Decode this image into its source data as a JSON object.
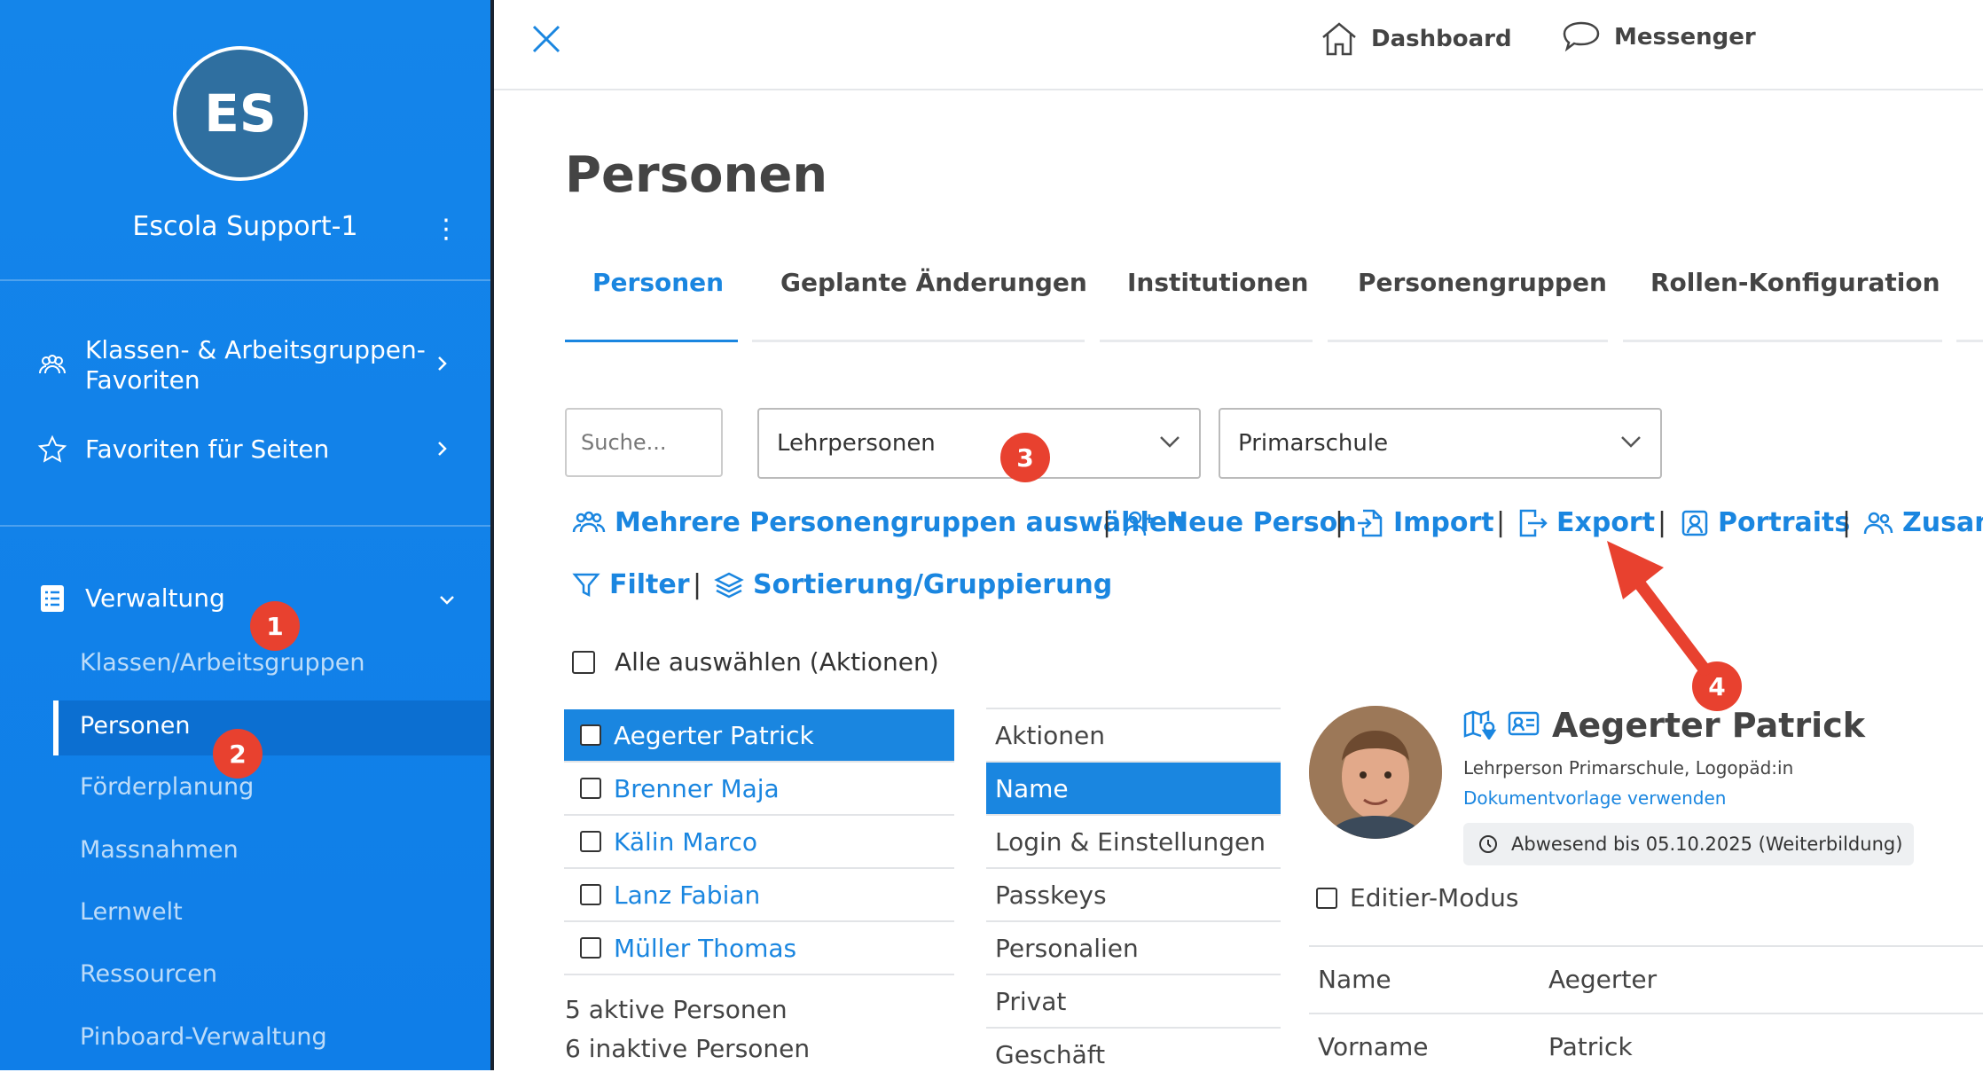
{
  "sidebar": {
    "avatar_initials": "ES",
    "username": "Escola Support-1",
    "favorites": [
      {
        "label_line1": "Klassen- & Arbeitsgruppen-",
        "label_line2": "Favoriten",
        "icon": "people-icon"
      },
      {
        "label": "Favoriten für Seiten",
        "icon": "star-icon"
      }
    ],
    "section": {
      "label": "Verwaltung",
      "icon": "list-icon"
    },
    "sub_items": [
      "Klassen/Arbeitsgruppen",
      "Personen",
      "Förderplanung",
      "Massnahmen",
      "Lernwelt",
      "Ressourcen",
      "Pinboard-Verwaltung"
    ],
    "active_sub": "Personen"
  },
  "topbar": {
    "dashboard": "Dashboard",
    "messenger": "Messenger"
  },
  "page": {
    "title": "Personen",
    "tabs": [
      "Personen",
      "Geplante Änderungen",
      "Institutionen",
      "Personengruppen",
      "Rollen-Konfiguration"
    ]
  },
  "filters": {
    "search_placeholder": "Suche...",
    "group_select": "Lehrpersonen",
    "school_select": "Primarschule"
  },
  "actions": {
    "multi_groups": "Mehrere Personengruppen auswählen",
    "new_person": "Neue Person",
    "import": "Import",
    "export": "Export",
    "portraits": "Portraits",
    "more": "Zusam",
    "filter": "Filter",
    "sort_group": "Sortierung/Gruppierung",
    "select_all": "Alle auswählen (Aktionen)"
  },
  "persons": [
    "Aegerter Patrick",
    "Brenner Maja",
    "Kälin Marco",
    "Lanz Fabian",
    "Müller Thomas"
  ],
  "counts": {
    "active": "5 aktive Personen",
    "inactive": "6 inaktive Personen"
  },
  "menu": [
    "Aktionen",
    "Name",
    "Login & Einstellungen",
    "Passkeys",
    "Personalien",
    "Privat",
    "Geschäft"
  ],
  "detail": {
    "name": "Aegerter Patrick",
    "role": "Lehrperson Primarschule, Logopäd:in",
    "doc_link": "Dokumentvorlage verwenden",
    "absence": "Abwesend bis 05.10.2025 (Weiterbildung)",
    "edit_mode": "Editier-Modus",
    "fields": [
      {
        "label": "Name",
        "value": "Aegerter"
      },
      {
        "label": "Vorname",
        "value": "Patrick"
      }
    ]
  },
  "annotations": [
    "1",
    "2",
    "3",
    "4"
  ],
  "colors": {
    "sidebar": "#1485ea",
    "accent": "#1a86e0",
    "badge": "#e8412f"
  }
}
